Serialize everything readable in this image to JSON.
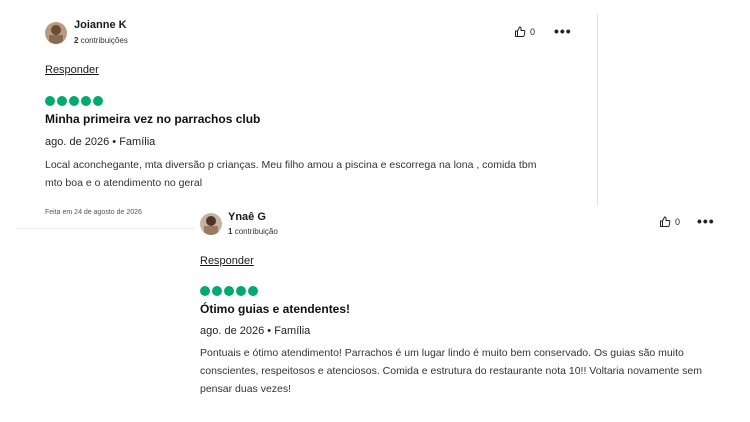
{
  "reviews": [
    {
      "author": "Joianne K",
      "contributions_count": "2",
      "contributions_label": "contribuições",
      "likes": "0",
      "reply_label": "Responder",
      "rating": 5,
      "title": "Minha primeira vez no parrachos club",
      "meta": "ago. de 2026 • Família",
      "text": "Local aconchegante, mta diversão p crianças. Meu filho amou a piscina e escorrega na lona , comida tbm mto boa e o atendimento no geral",
      "written": "Feita em 24 de agosto de 2026"
    },
    {
      "author": "Ynaê G",
      "contributions_count": "1",
      "contributions_label": "contribuição",
      "likes": "0",
      "reply_label": "Responder",
      "rating": 5,
      "title": "Ótimo guias e atendentes!",
      "meta": "ago. de 2026 • Família",
      "text": "Pontuais e ótimo atendimento! Parrachos é um lugar lindo é muito bem conservado. Os guias são muito conscientes, respeitosos e atenciosos. Comida e estrutura do restaurante nota 10!! Voltaria novamente sem pensar duas vezes!"
    }
  ],
  "colors": {
    "rating": "#00aa6c"
  },
  "icons": {
    "like": "thumbs-up-icon",
    "more": "more-options-icon"
  }
}
